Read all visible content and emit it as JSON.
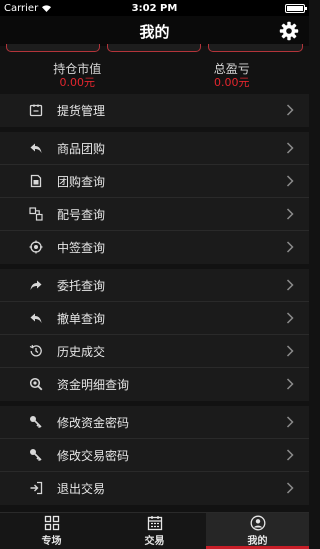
{
  "status_bar": {
    "carrier": "Carrier",
    "time": "3:02 PM"
  },
  "nav": {
    "title": "我的",
    "settings_icon": "gear-icon"
  },
  "summary": {
    "holdings_label": "持仓市值",
    "holdings_value": "0.00元",
    "pnl_label": "总盈亏",
    "pnl_value": "0.00元",
    "value_color": "#e3262e"
  },
  "menu_groups": [
    {
      "items": [
        {
          "label": "提货管理",
          "icon": "pickup-icon"
        }
      ]
    },
    {
      "items": [
        {
          "label": "商品团购",
          "icon": "reply-icon"
        },
        {
          "label": "团购查询",
          "icon": "document-icon"
        },
        {
          "label": "配号查询",
          "icon": "number-icon"
        },
        {
          "label": "中签查询",
          "icon": "target-icon"
        }
      ]
    },
    {
      "items": [
        {
          "label": "委托查询",
          "icon": "forward-icon"
        },
        {
          "label": "撤单查询",
          "icon": "undo-icon"
        },
        {
          "label": "历史成交",
          "icon": "history-icon"
        },
        {
          "label": "资金明细查询",
          "icon": "search-icon"
        }
      ]
    },
    {
      "items": [
        {
          "label": "修改资金密码",
          "icon": "key-icon"
        },
        {
          "label": "修改交易密码",
          "icon": "key-icon"
        },
        {
          "label": "退出交易",
          "icon": "logout-icon"
        }
      ]
    }
  ],
  "tab_bar": {
    "tabs": [
      {
        "label": "专场",
        "icon": "grid-icon"
      },
      {
        "label": "交易",
        "icon": "calendar-icon"
      },
      {
        "label": "我的",
        "icon": "user-icon",
        "active": true
      }
    ],
    "accent": "#c81e28"
  }
}
